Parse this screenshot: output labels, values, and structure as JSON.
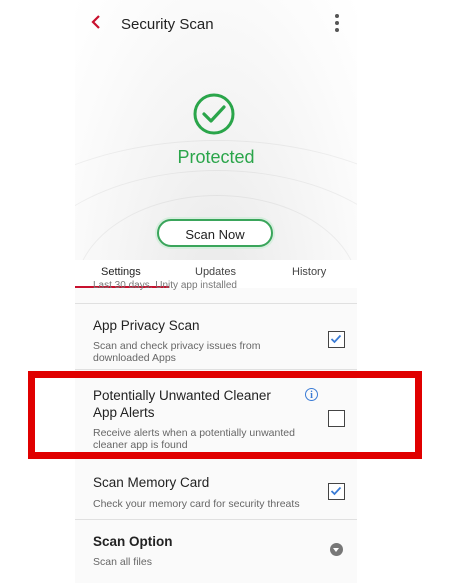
{
  "header": {
    "back_icon": "chevron-left-icon",
    "title": "Security Scan",
    "menu_icon": "more-vertical-icon"
  },
  "status": {
    "icon": "check-circle-icon",
    "text": "Protected",
    "color": "#2aa54a"
  },
  "scan_button": {
    "label": "Scan Now"
  },
  "tabs": [
    {
      "label": "Settings",
      "active": true
    },
    {
      "label": "Updates",
      "active": false
    },
    {
      "label": "History",
      "active": false
    }
  ],
  "list": {
    "clipped_text": "Last 30 days. Unity app installed",
    "items": [
      {
        "title": "App Privacy Scan",
        "description": "Scan and check privacy issues from downloaded Apps",
        "checked": true
      },
      {
        "title": "Potentially Unwanted Cleaner App Alerts",
        "description": "Receive alerts when a potentially unwanted cleaner app is found",
        "checked": false,
        "info_icon": "info-icon"
      },
      {
        "title": "Scan Memory Card",
        "description": "Check your memory card for security threats",
        "checked": true
      },
      {
        "title": "Scan Option",
        "description": "Scan all files",
        "dropdown_icon": "dropdown-icon"
      }
    ]
  },
  "colors": {
    "accent": "#c8102e",
    "protected": "#2aa54a",
    "checkbox_check": "#3a7bd5",
    "highlight": "#e00000"
  }
}
